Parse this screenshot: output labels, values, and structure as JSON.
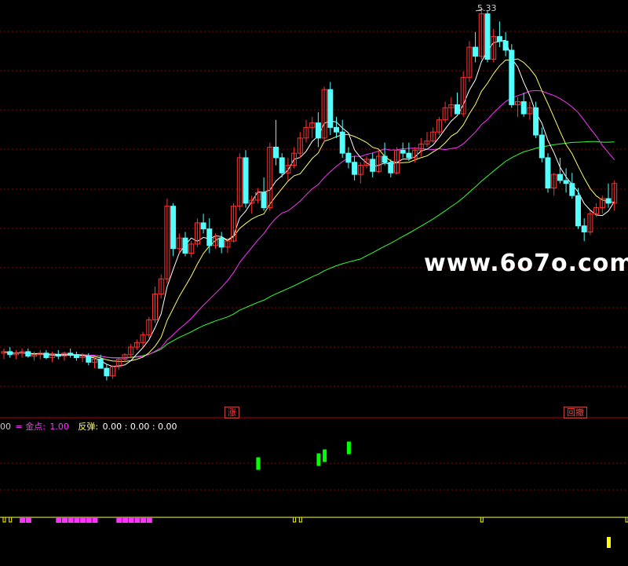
{
  "colors": {
    "up": "#ff3333",
    "down": "#54ffff",
    "ma5": "#ffffff",
    "ma10": "#ffff66",
    "ma20": "#ff33ff",
    "ma60": "#33ff33",
    "grid": "#8b0000",
    "separator": "#b00000",
    "signal_green": "#00ff00",
    "signal_yellow": "#ffff00",
    "signal_magenta": "#ff33ff"
  },
  "watermark": "www.6o7o.com",
  "high_label": "5.33",
  "tags": {
    "rise": "涨",
    "pullback": "回撤"
  },
  "legend": {
    "prefix": "00",
    "gold_label": "= 金点:",
    "gold_value": "1.00",
    "rebound_label": "反弹:",
    "rebound_values": "0.00 : 0.00 : 0.00"
  },
  "chart_data": {
    "type": "candlestick",
    "title": "",
    "candles": [
      [
        3.06,
        3.09,
        3.02,
        3.07
      ],
      [
        3.07,
        3.1,
        3.03,
        3.05
      ],
      [
        3.05,
        3.08,
        3.02,
        3.06
      ],
      [
        3.06,
        3.09,
        3.03,
        3.07
      ],
      [
        3.07,
        3.09,
        3.03,
        3.04
      ],
      [
        3.04,
        3.07,
        3.01,
        3.05
      ],
      [
        3.05,
        3.08,
        3.02,
        3.06
      ],
      [
        3.06,
        3.08,
        3.02,
        3.03
      ],
      [
        3.03,
        3.07,
        3.0,
        3.05
      ],
      [
        3.05,
        3.08,
        3.02,
        3.04
      ],
      [
        3.04,
        3.07,
        3.01,
        3.06
      ],
      [
        3.06,
        3.09,
        3.03,
        3.05
      ],
      [
        3.05,
        3.07,
        3.01,
        3.03
      ],
      [
        3.03,
        3.06,
        3.0,
        3.04
      ],
      [
        3.04,
        3.06,
        2.98,
        3.0
      ],
      [
        3.0,
        3.03,
        2.96,
        3.02
      ],
      [
        3.02,
        3.05,
        2.99,
        2.96
      ],
      [
        2.96,
        2.99,
        2.88,
        2.91
      ],
      [
        2.91,
        2.98,
        2.89,
        2.97
      ],
      [
        2.97,
        3.03,
        2.95,
        3.02
      ],
      [
        3.02,
        3.06,
        3.0,
        3.05
      ],
      [
        3.05,
        3.12,
        3.03,
        3.1
      ],
      [
        3.1,
        3.15,
        3.08,
        3.13
      ],
      [
        3.13,
        3.2,
        3.1,
        3.18
      ],
      [
        3.18,
        3.3,
        3.16,
        3.28
      ],
      [
        3.28,
        3.5,
        3.26,
        3.45
      ],
      [
        3.45,
        3.58,
        3.42,
        3.55
      ],
      [
        3.55,
        4.08,
        3.52,
        4.03
      ],
      [
        4.03,
        4.05,
        3.7,
        3.75
      ],
      [
        3.75,
        3.85,
        3.72,
        3.82
      ],
      [
        3.82,
        3.86,
        3.7,
        3.72
      ],
      [
        3.72,
        3.8,
        3.69,
        3.78
      ],
      [
        3.78,
        3.95,
        3.76,
        3.92
      ],
      [
        3.92,
        3.98,
        3.85,
        3.88
      ],
      [
        3.88,
        3.95,
        3.72,
        3.77
      ],
      [
        3.77,
        3.85,
        3.75,
        3.82
      ],
      [
        3.82,
        3.86,
        3.72,
        3.76
      ],
      [
        3.76,
        3.82,
        3.72,
        3.8
      ],
      [
        3.8,
        4.05,
        3.79,
        4.03
      ],
      [
        4.03,
        4.38,
        4.0,
        4.35
      ],
      [
        4.35,
        4.4,
        4.02,
        4.05
      ],
      [
        4.05,
        4.1,
        3.98,
        4.07
      ],
      [
        4.07,
        4.15,
        4.05,
        4.12
      ],
      [
        4.12,
        4.22,
        4.0,
        4.02
      ],
      [
        4.02,
        4.45,
        4.0,
        4.42
      ],
      [
        4.42,
        4.6,
        4.3,
        4.35
      ],
      [
        4.35,
        4.38,
        4.22,
        4.25
      ],
      [
        4.25,
        4.35,
        4.2,
        4.3
      ],
      [
        4.3,
        4.42,
        4.28,
        4.38
      ],
      [
        4.38,
        4.52,
        4.35,
        4.48
      ],
      [
        4.48,
        4.6,
        4.45,
        4.55
      ],
      [
        4.55,
        4.62,
        4.48,
        4.58
      ],
      [
        4.58,
        4.65,
        4.42,
        4.48
      ],
      [
        4.48,
        4.82,
        4.45,
        4.8
      ],
      [
        4.8,
        4.85,
        4.5,
        4.55
      ],
      [
        4.55,
        4.62,
        4.48,
        4.52
      ],
      [
        4.52,
        4.6,
        4.35,
        4.38
      ],
      [
        4.38,
        4.42,
        4.28,
        4.32
      ],
      [
        4.32,
        4.36,
        4.2,
        4.24
      ],
      [
        4.24,
        4.32,
        4.18,
        4.3
      ],
      [
        4.3,
        4.36,
        4.28,
        4.34
      ],
      [
        4.34,
        4.38,
        4.22,
        4.26
      ],
      [
        4.26,
        4.4,
        4.25,
        4.36
      ],
      [
        4.36,
        4.45,
        4.3,
        4.32
      ],
      [
        4.32,
        4.34,
        4.22,
        4.25
      ],
      [
        4.25,
        4.42,
        4.24,
        4.4
      ],
      [
        4.4,
        4.45,
        4.35,
        4.38
      ],
      [
        4.38,
        4.45,
        4.33,
        4.35
      ],
      [
        4.35,
        4.42,
        4.32,
        4.4
      ],
      [
        4.4,
        4.48,
        4.36,
        4.44
      ],
      [
        4.44,
        4.52,
        4.42,
        4.46
      ],
      [
        4.46,
        4.55,
        4.45,
        4.52
      ],
      [
        4.52,
        4.62,
        4.5,
        4.6
      ],
      [
        4.6,
        4.72,
        4.58,
        4.68
      ],
      [
        4.68,
        4.75,
        4.62,
        4.7
      ],
      [
        4.7,
        4.78,
        4.66,
        4.64
      ],
      [
        4.64,
        4.92,
        4.62,
        4.88
      ],
      [
        4.88,
        5.12,
        4.85,
        5.08
      ],
      [
        5.08,
        5.18,
        4.98,
        5.02
      ],
      [
        5.02,
        5.33,
        5.0,
        5.3
      ],
      [
        5.3,
        5.32,
        4.98,
        5.0
      ],
      [
        5.0,
        5.2,
        4.98,
        5.15
      ],
      [
        5.15,
        5.25,
        5.08,
        5.12
      ],
      [
        5.12,
        5.18,
        5.02,
        5.06
      ],
      [
        5.06,
        5.1,
        4.68,
        4.7
      ],
      [
        4.7,
        4.75,
        4.62,
        4.72
      ],
      [
        4.72,
        4.78,
        4.62,
        4.64
      ],
      [
        4.64,
        4.72,
        4.6,
        4.68
      ],
      [
        4.68,
        4.72,
        4.48,
        4.5
      ],
      [
        4.5,
        4.55,
        4.32,
        4.35
      ],
      [
        4.35,
        4.38,
        4.12,
        4.15
      ],
      [
        4.15,
        4.25,
        4.1,
        4.24
      ],
      [
        4.24,
        4.35,
        4.18,
        4.2
      ],
      [
        4.2,
        4.28,
        4.12,
        4.18
      ],
      [
        4.18,
        4.25,
        4.08,
        4.1
      ],
      [
        4.1,
        4.15,
        3.88,
        3.9
      ],
      [
        3.9,
        3.95,
        3.8,
        3.86
      ],
      [
        3.86,
        4.0,
        3.84,
        3.98
      ],
      [
        3.98,
        4.05,
        3.96,
        4.02
      ],
      [
        4.02,
        4.1,
        3.98,
        4.08
      ],
      [
        4.08,
        4.18,
        4.02,
        4.05
      ],
      [
        4.05,
        4.2,
        4.0,
        4.18
      ]
    ],
    "ylim": [
      2.8,
      5.35
    ],
    "indicator_lines": [
      "MA5",
      "MA10",
      "MA20",
      "MA60"
    ],
    "signals": {
      "green_bars": [
        [
          42,
          0.55
        ],
        [
          52,
          0.65
        ],
        [
          53,
          0.75
        ],
        [
          57,
          0.95
        ]
      ],
      "yellow_bars": [
        [
          100,
          0.6
        ],
        [
          104,
          0.5
        ]
      ],
      "magenta_blocks": [
        3,
        4,
        9,
        10,
        11,
        12,
        13,
        14,
        15,
        19,
        20,
        21,
        22,
        23,
        24
      ]
    }
  }
}
